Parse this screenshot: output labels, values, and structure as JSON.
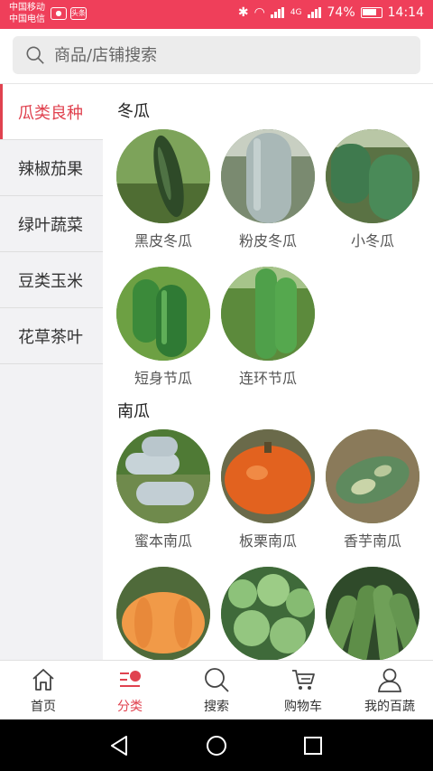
{
  "status_bar": {
    "carrier1": "中国移动",
    "carrier2": "中国电信",
    "app_badge": "头条",
    "network": "4G",
    "battery": "74%",
    "time": "14:14"
  },
  "search": {
    "placeholder": "商品/店铺搜索"
  },
  "sidebar": {
    "items": [
      {
        "label": "瓜类良种"
      },
      {
        "label": "辣椒茄果"
      },
      {
        "label": "绿叶蔬菜"
      },
      {
        "label": "豆类玉米"
      },
      {
        "label": "花草茶叶"
      }
    ]
  },
  "sections": [
    {
      "title": "冬瓜",
      "products": [
        {
          "name": "黑皮冬瓜",
          "icon": "dark-winter-melon"
        },
        {
          "name": "粉皮冬瓜",
          "icon": "powdery-winter-melon"
        },
        {
          "name": "小冬瓜",
          "icon": "small-winter-melon"
        },
        {
          "name": "短身节瓜",
          "icon": "short-node-melon"
        },
        {
          "name": "连环节瓜",
          "icon": "linked-node-melon"
        }
      ]
    },
    {
      "title": "南瓜",
      "products": [
        {
          "name": "蜜本南瓜",
          "icon": "butternut-pumpkin"
        },
        {
          "name": "板栗南瓜",
          "icon": "chestnut-pumpkin"
        },
        {
          "name": "香芋南瓜",
          "icon": "taro-pumpkin"
        },
        {
          "name": "",
          "icon": "orange-pumpkin"
        },
        {
          "name": "",
          "icon": "round-zucchini"
        },
        {
          "name": "",
          "icon": "long-zucchini"
        }
      ]
    }
  ],
  "tabbar": {
    "tabs": [
      {
        "label": "首页"
      },
      {
        "label": "分类"
      },
      {
        "label": "搜索"
      },
      {
        "label": "购物车"
      },
      {
        "label": "我的百蔬"
      }
    ]
  },
  "colors": {
    "accent": "#e0424f",
    "status_bar": "#ef3f5a"
  }
}
